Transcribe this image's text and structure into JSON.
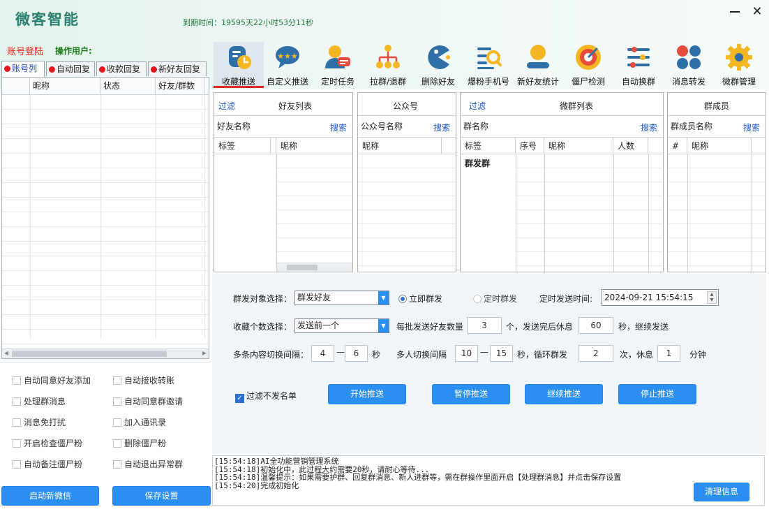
{
  "app": {
    "title": "微客智能",
    "expire_text": "到期时间：19595天22小时53分11秒",
    "account_login": "账号登陆",
    "operator": "操作用户:"
  },
  "left_tabs": [
    "账号列",
    "自动回复",
    "收款回复",
    "新好友回复"
  ],
  "left_grid": {
    "columns": [
      "昵称",
      "状态",
      "好友/群数"
    ]
  },
  "left_options": [
    "自动同意好友添加",
    "自动接收转账",
    "处理群消息",
    "自动同意群邀请",
    "消息免打扰",
    "加入通讯录",
    "开启检查僵尸粉",
    "删除僵尸粉",
    "自动备注僵尸粉",
    "自动退出异常群"
  ],
  "left_buttons": {
    "start_wechat": "启动新微信",
    "save_settings": "保存设置"
  },
  "toolbar": [
    {
      "label": "收藏推送",
      "icon": "clock-doc-icon"
    },
    {
      "label": "自定义推送",
      "icon": "star-bubble-icon"
    },
    {
      "label": "定时任务",
      "icon": "user-chat-icon"
    },
    {
      "label": "拉群/退群",
      "icon": "org-tree-icon"
    },
    {
      "label": "删除好友",
      "icon": "pacman-icon"
    },
    {
      "label": "爆粉手机号",
      "icon": "list-search-icon"
    },
    {
      "label": "新好友统计",
      "icon": "user-bar-icon"
    },
    {
      "label": "僵尸检测",
      "icon": "target-icon"
    },
    {
      "label": "自动换群",
      "icon": "sliders-icon"
    },
    {
      "label": "消息转发",
      "icon": "dots-grid-icon"
    },
    {
      "label": "微群管理",
      "icon": "gear-icon"
    }
  ],
  "panels": {
    "friends": {
      "filter": "过滤",
      "title": "好友列表",
      "search_label": "好友名称",
      "search": "搜索",
      "cols": [
        "标签",
        "昵称"
      ]
    },
    "official": {
      "title": "公众号",
      "search_label": "公众号名称",
      "search": "搜索",
      "cols": [
        "昵称"
      ]
    },
    "groups": {
      "filter": "过滤",
      "title": "微群列表",
      "search_label": "群名称",
      "search": "搜索",
      "cols": [
        "标签",
        "序号",
        "昵称",
        "人数"
      ],
      "first_tag": "群发群"
    },
    "members": {
      "title": "群成员",
      "search_label": "群成员名称",
      "search": "搜索",
      "cols": [
        "#",
        "昵称"
      ]
    }
  },
  "settings": {
    "target_label": "群发对象选择：",
    "target_value": "群发好友",
    "radio_now": "立即群发",
    "radio_timed": "定时群发",
    "timed_label": "定时发送时间:",
    "timed_value": "2024-09-21 15:54:15",
    "fav_label": "收藏个数选择：",
    "fav_value": "发送前一个",
    "batch_label": "每批发送好友数量",
    "batch_value": "3",
    "batch_mid": "个，发送完后休息",
    "rest_value": "60",
    "rest_unit": "秒，继续发送",
    "multi_label": "多条内容切换间隔：",
    "multi_min": "4",
    "dash1": "—",
    "multi_max": "6",
    "sec1": "秒",
    "person_label": "多人切换间隔",
    "person_min": "10",
    "dash2": "—",
    "person_max": "15",
    "loop_label": "秒，循环群发",
    "loop_value": "2",
    "times_label": "次，休息",
    "break_value": "1",
    "minute": "分钟",
    "filter_label": "过滤不发名单",
    "btn_start": "开始推送",
    "btn_pause": "暂停推送",
    "btn_resume": "继续推送",
    "btn_stop": "停止推送"
  },
  "log": {
    "lines": [
      "[15:54:18]AI全功能营销管理系统",
      "[15:54:18]初始化中，此过程大约需要20秒，请耐心等待...",
      "[15:54:18]温馨提示：如果需要护群、回复群消息、新人进群等，需在群操作里面开启【处理群消息】并点击保存设置",
      "[15:54:20]完成初始化"
    ],
    "clear": "清理信息"
  },
  "colors": {
    "accent": "#2a8ff0",
    "danger": "#e3141c",
    "brand": "#2a7f6f"
  }
}
